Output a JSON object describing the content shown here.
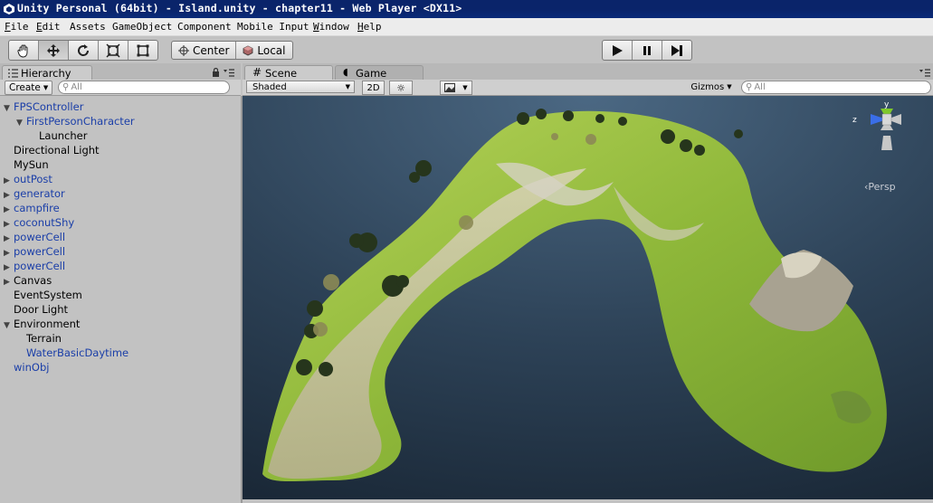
{
  "window": {
    "title": "Unity Personal (64bit) - Island.unity - chapter11 - Web Player <DX11>"
  },
  "menu": [
    {
      "label": "File",
      "u": "F",
      "rest": "ile"
    },
    {
      "label": "Edit",
      "u": "E",
      "rest": "dit"
    },
    {
      "label": "Assets",
      "u": "",
      "rest": "Assets"
    },
    {
      "label": "GameObject",
      "u": "",
      "rest": "GameObject"
    },
    {
      "label": "Component",
      "u": "",
      "rest": "Component"
    },
    {
      "label": "Mobile Input",
      "u": "",
      "rest": "Mobile Input"
    },
    {
      "label": "Window",
      "u": "W",
      "rest": "indow"
    },
    {
      "label": "Help",
      "u": "H",
      "rest": "elp"
    }
  ],
  "toolbar": {
    "pivot_center": "Center",
    "pivot_local": "Local"
  },
  "hierarchy": {
    "tab_label": "Hierarchy",
    "create_label": "Create",
    "search_placeholder": "All",
    "items": [
      {
        "label": "FPSController",
        "depth": 0,
        "expanded": true,
        "hasChildren": true,
        "prefab": true
      },
      {
        "label": "FirstPersonCharacter",
        "depth": 1,
        "expanded": true,
        "hasChildren": true,
        "prefab": true
      },
      {
        "label": "Launcher",
        "depth": 2,
        "expanded": false,
        "hasChildren": false,
        "prefab": false
      },
      {
        "label": "Directional Light",
        "depth": 0,
        "expanded": false,
        "hasChildren": false,
        "prefab": false
      },
      {
        "label": "MySun",
        "depth": 0,
        "expanded": false,
        "hasChildren": false,
        "prefab": false
      },
      {
        "label": "outPost",
        "depth": 0,
        "expanded": false,
        "hasChildren": true,
        "prefab": true
      },
      {
        "label": "generator",
        "depth": 0,
        "expanded": false,
        "hasChildren": true,
        "prefab": true
      },
      {
        "label": "campfire",
        "depth": 0,
        "expanded": false,
        "hasChildren": true,
        "prefab": true
      },
      {
        "label": "coconutShy",
        "depth": 0,
        "expanded": false,
        "hasChildren": true,
        "prefab": true
      },
      {
        "label": "powerCell",
        "depth": 0,
        "expanded": false,
        "hasChildren": true,
        "prefab": true
      },
      {
        "label": "powerCell",
        "depth": 0,
        "expanded": false,
        "hasChildren": true,
        "prefab": true
      },
      {
        "label": "powerCell",
        "depth": 0,
        "expanded": false,
        "hasChildren": true,
        "prefab": true
      },
      {
        "label": "Canvas",
        "depth": 0,
        "expanded": false,
        "hasChildren": true,
        "prefab": false
      },
      {
        "label": "EventSystem",
        "depth": 0,
        "expanded": false,
        "hasChildren": false,
        "prefab": false
      },
      {
        "label": "Door Light",
        "depth": 0,
        "expanded": false,
        "hasChildren": false,
        "prefab": false
      },
      {
        "label": "Environment",
        "depth": 0,
        "expanded": true,
        "hasChildren": true,
        "prefab": false
      },
      {
        "label": "Terrain",
        "depth": 1,
        "expanded": false,
        "hasChildren": false,
        "prefab": false
      },
      {
        "label": "WaterBasicDaytime",
        "depth": 1,
        "expanded": false,
        "hasChildren": false,
        "prefab": true
      },
      {
        "label": "winObj",
        "depth": 0,
        "expanded": false,
        "hasChildren": false,
        "prefab": true
      }
    ]
  },
  "scene": {
    "tab_scene": "Scene",
    "tab_game": "Game",
    "shading_mode": "Shaded",
    "mode_2d": "2D",
    "gizmos_label": "Gizmos",
    "search_placeholder": "All",
    "projection_label": "Persp",
    "axis_y": "y",
    "axis_z": "z"
  },
  "colors": {
    "title_bar": "#0a246a",
    "prefab_text": "#1a3ea8",
    "sky_top": "#4a6782",
    "sky_bottom": "#1b2b3b",
    "gizmo_y": "#7ec82a",
    "gizmo_z": "#3a6ee8"
  },
  "icons": {
    "hand": "hand-icon",
    "move": "move-icon",
    "rotate": "rotate-icon",
    "scale": "scale-icon",
    "rect": "rect-tool-icon",
    "play": "play-icon",
    "pause": "pause-icon",
    "step": "step-icon"
  }
}
